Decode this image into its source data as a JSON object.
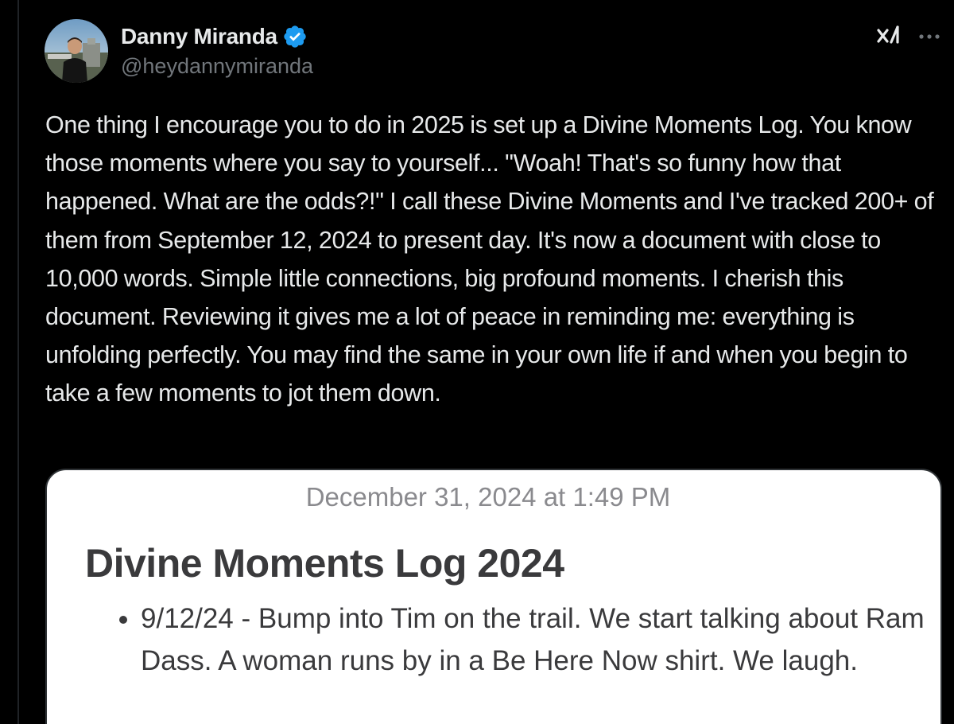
{
  "author": {
    "display_name": "Danny Miranda",
    "handle": "@heydannymiranda",
    "verified": true
  },
  "icons": {
    "verified": "verified-badge-icon",
    "grok": "grok-icon",
    "more": "more-options-icon",
    "avatar": "profile-photo"
  },
  "colors": {
    "background": "#000000",
    "text": "#e7e9ea",
    "secondary_text": "#71767b",
    "verified_blue": "#1d9bf0"
  },
  "tweet": {
    "text": "One thing I encourage you to do in 2025 is set up a Divine Moments Log. You know those moments where you say to yourself... \"Woah! That's so funny how that happened. What are the odds?!\" I call these Divine Moments and I've tracked 200+ of them from September 12, 2024 to present day. It's now a document with close to 10,000 words. Simple little connections, big profound moments. I cherish this document. Reviewing it gives me a lot of peace in reminding me: everything is unfolding perfectly. You may find the same in your own life if and when you begin to take a few moments to jot them down."
  },
  "media": {
    "note_date": "December 31, 2024 at 1:49 PM",
    "note_title": "Divine Moments Log 2024",
    "entries": [
      "9/12/24 - Bump into Tim on the trail. We start talking about Ram Dass. A woman runs by in a Be Here Now shirt. We laugh."
    ]
  }
}
